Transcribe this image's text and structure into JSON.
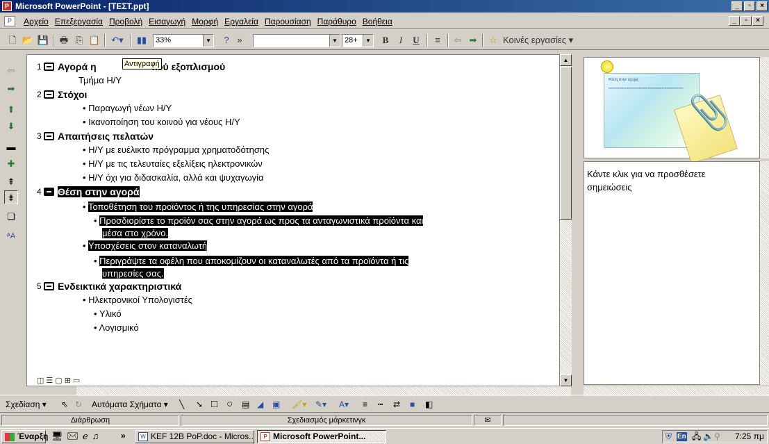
{
  "window": {
    "title": "Microsoft PowerPoint - [ΤΕΣΤ.ppt]",
    "min": "_",
    "max": "▫",
    "close": "×"
  },
  "menu": [
    "Αρχείο",
    "Επεξεργασία",
    "Προβολή",
    "Εισαγωγή",
    "Μορφή",
    "Εργαλεία",
    "Παρουσίαση",
    "Παράθυρο",
    "Βοήθεια"
  ],
  "toolbar": {
    "zoom": "33%",
    "font_size": "28+",
    "bold": "B",
    "italic": "I",
    "underline": "U",
    "tasks": "Κοινές εργασίες"
  },
  "tooltip": "Αντιγραφή",
  "outline": {
    "slides": [
      {
        "num": "1",
        "title": "Αγορά ηλεκτρονικού εξοπλισμού",
        "partial_title": "Αγορά η",
        "partial_title_end": "κού εξοπλισμού",
        "subtitle": "Τμήμα Η/Υ"
      },
      {
        "num": "2",
        "title": "Στόχοι",
        "bullets": [
          "Παραγωγή νέων Η/Υ",
          "Ικανοποίηση του κοινού για νέους Η/Υ"
        ]
      },
      {
        "num": "3",
        "title": "Απαιτήσεις πελατών",
        "bullets": [
          "Η/Υ με ευέλικτο πρόγραμμα χρηματοδότησης",
          "Η/Υ με τις τελευταίες εξελίξεις ηλεκτρονικών",
          "Η/Υ όχι για διδασκαλία, αλλά και ψυχαγωγία"
        ]
      },
      {
        "num": "4",
        "title": "Θέση στην αγορά",
        "b1": "Τοποθέτηση του προϊόντος ή της υπηρεσίας στην αγορά",
        "b1s1a": "Προσδιορίστε το προϊόν σας στην αγορά ως προς τα ανταγωνιστικά προϊόντα και",
        "b1s1b": "μέσα στο χρόνο.",
        "b2": "Υποσχέσεις στον καταναλωτή",
        "b2s1a": "Περιγράψτε τα οφέλη που αποκομίζουν οι καταναλωτές από τα προϊόντα ή τις",
        "b2s1b": "υπηρεσίες σας."
      },
      {
        "num": "5",
        "title": "Ενδεικτικά χαρακτηριστικά",
        "bullets": [
          "Ηλεκτρονικοί Υπολογιστές"
        ],
        "subbullets": [
          "Υλικό",
          "Λογισμικό"
        ]
      }
    ]
  },
  "slide_thumb": {
    "title": "Θέση στην αγορά"
  },
  "notes": {
    "placeholder": "Κάντε κλικ για να προσθέσετε σημειώσεις"
  },
  "drawing": {
    "design": "Σχεδίαση",
    "autoshapes": "Αυτόματα Σχήματα"
  },
  "status": {
    "view": "Διάρθρωση",
    "template": "Σχεδιασμός μάρκετινγκ"
  },
  "taskbar": {
    "start": "Έναρξη",
    "task1": "KEF 12B PoP.doc - Micros...",
    "task2": "Microsoft PowerPoint...",
    "lang": "En",
    "time": "7:25 πμ",
    "chev": "»"
  }
}
